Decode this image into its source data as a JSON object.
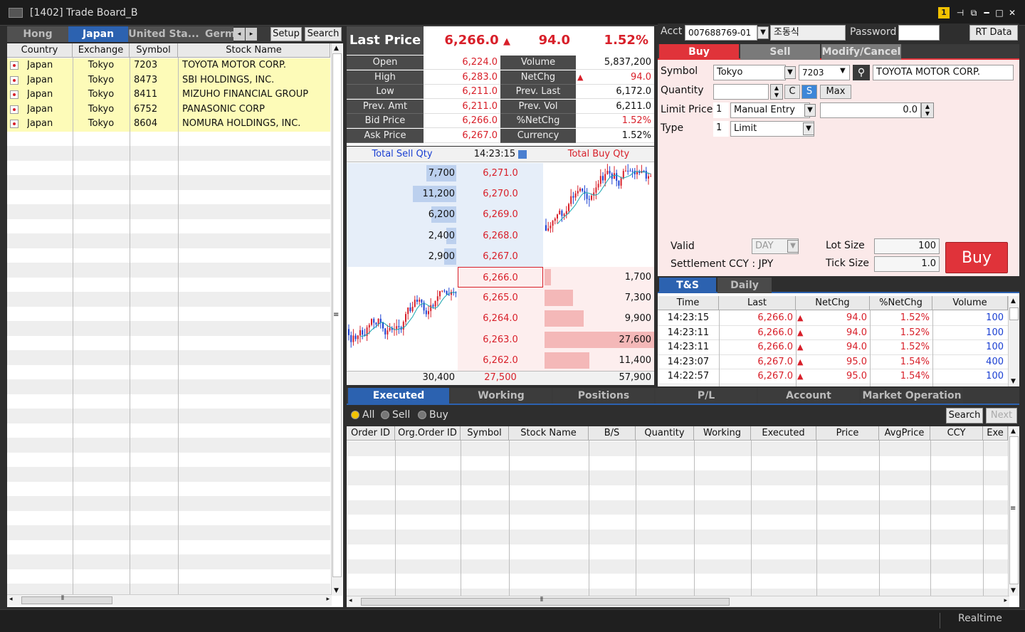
{
  "window": {
    "title": "[1402] Trade Board_B",
    "badge": "1"
  },
  "markets": {
    "tabs": [
      "Hong Kong",
      "Japan",
      "United Sta...",
      "Germ"
    ],
    "active": "Japan",
    "setup_label": "Setup",
    "search_label": "Search"
  },
  "stocks": {
    "headers": [
      "Country",
      "Exchange",
      "Symbol",
      "Stock Name"
    ],
    "rows": [
      {
        "country": "Japan",
        "exchange": "Tokyo",
        "symbol": "7203",
        "name": "TOYOTA MOTOR CORP."
      },
      {
        "country": "Japan",
        "exchange": "Tokyo",
        "symbol": "8473",
        "name": "SBI HOLDINGS, INC."
      },
      {
        "country": "Japan",
        "exchange": "Tokyo",
        "symbol": "8411",
        "name": "MIZUHO FINANCIAL GROUP"
      },
      {
        "country": "Japan",
        "exchange": "Tokyo",
        "symbol": "6752",
        "name": "PANASONIC CORP"
      },
      {
        "country": "Japan",
        "exchange": "Tokyo",
        "symbol": "8604",
        "name": "NOMURA HOLDINGS, INC."
      }
    ]
  },
  "quote": {
    "last_price_label": "Last Price",
    "last_price": "6,266.0",
    "change": "94.0",
    "pct": "1.52%",
    "fields_left": [
      {
        "label": "Open",
        "value": "6,224.0"
      },
      {
        "label": "High",
        "value": "6,283.0"
      },
      {
        "label": "Low",
        "value": "6,211.0"
      },
      {
        "label": "Prev. Amt",
        "value": "6,211.0"
      },
      {
        "label": "Bid Price",
        "value": "6,266.0"
      },
      {
        "label": "Ask Price",
        "value": "6,267.0"
      }
    ],
    "fields_right": [
      {
        "label": "Volume",
        "value": "5,837,200"
      },
      {
        "label": "NetChg",
        "value": "94.0"
      },
      {
        "label": "Prev. Last",
        "value": "6,172.0"
      },
      {
        "label": "Prev. Vol",
        "value": "6,211.0"
      },
      {
        "label": "%NetChg",
        "value": "1.52%"
      },
      {
        "label": "Currency",
        "value": "1.52%"
      }
    ]
  },
  "orderbook": {
    "sell_label": "Total Sell Qty",
    "time": "14:23:15",
    "buy_label": "Total Buy Qty",
    "asks": [
      {
        "qty": "7,700",
        "price": "6,271.0",
        "frac": 0.28
      },
      {
        "qty": "11,200",
        "price": "6,270.0",
        "frac": 0.41
      },
      {
        "qty": "6,200",
        "price": "6,269.0",
        "frac": 0.23
      },
      {
        "qty": "2,400",
        "price": "6,268.0",
        "frac": 0.09
      },
      {
        "qty": "2,900",
        "price": "6,267.0",
        "frac": 0.11
      }
    ],
    "bids": [
      {
        "price": "6,266.0",
        "qty": "1,700",
        "frac": 0.06
      },
      {
        "price": "6,265.0",
        "qty": "7,300",
        "frac": 0.26
      },
      {
        "price": "6,264.0",
        "qty": "9,900",
        "frac": 0.36
      },
      {
        "price": "6,263.0",
        "qty": "27,600",
        "frac": 1.0
      },
      {
        "price": "6,262.0",
        "qty": "11,400",
        "frac": 0.41
      }
    ],
    "total_sell": "30,400",
    "total_mid": "27,500",
    "total_buy": "57,900"
  },
  "account": {
    "acct_label": "Acct",
    "acct_value": "007688769-01",
    "owner": "조동식",
    "password_label": "Password",
    "rt_label": "RT Data"
  },
  "order": {
    "tabs": [
      "Buy",
      "Sell",
      "Modify/Cancel"
    ],
    "symbol_label": "Symbol",
    "exchange": "Tokyo",
    "symbol": "7203",
    "stock_name": "TOYOTA MOTOR CORP.",
    "quantity_label": "Quantity",
    "c_label": "C",
    "s_label": "S",
    "max_label": "Max",
    "limit_label": "Limit Price",
    "limit_code": "1",
    "limit_mode": "Manual Entry",
    "limit_value": "0.0",
    "type_label": "Type",
    "type_code": "1",
    "type_value": "Limit",
    "valid_label": "Valid",
    "valid_value": "DAY",
    "lot_label": "Lot Size",
    "lot_value": "100",
    "ccy_label": "Settlement CCY : JPY",
    "tick_label": "Tick Size",
    "tick_value": "1.0",
    "buy_button": "Buy"
  },
  "ts": {
    "tabs": [
      "T&S",
      "Daily"
    ],
    "headers": [
      "Time",
      "Last",
      "NetChg",
      "%NetChg",
      "Volume"
    ],
    "rows": [
      {
        "time": "14:23:15",
        "last": "6,266.0",
        "chg": "94.0",
        "pct": "1.52%",
        "vol": "100"
      },
      {
        "time": "14:23:11",
        "last": "6,266.0",
        "chg": "94.0",
        "pct": "1.52%",
        "vol": "100"
      },
      {
        "time": "14:23:11",
        "last": "6,266.0",
        "chg": "94.0",
        "pct": "1.52%",
        "vol": "100"
      },
      {
        "time": "14:23:07",
        "last": "6,267.0",
        "chg": "95.0",
        "pct": "1.54%",
        "vol": "400"
      },
      {
        "time": "14:22:57",
        "last": "6,267.0",
        "chg": "95.0",
        "pct": "1.54%",
        "vol": "100"
      }
    ]
  },
  "orders": {
    "tabs": [
      "Executed",
      "Working",
      "Positions",
      "P/L",
      "Account",
      "Market Operation"
    ],
    "filters": [
      "All",
      "Sell",
      "Buy"
    ],
    "search_label": "Search",
    "next_label": "Next",
    "headers": [
      "Order ID",
      "Org.Order ID",
      "Symbol",
      "Stock Name",
      "B/S",
      "Quantity",
      "Working",
      "Executed",
      "Price",
      "AvgPrice",
      "CCY",
      "Exe"
    ]
  },
  "status": {
    "mode": "Realtime"
  },
  "colors": {
    "accent": "#2c62b0",
    "up": "#d8202a",
    "buy_btn": "#e0333a",
    "highlight": "#fdfbb8"
  }
}
